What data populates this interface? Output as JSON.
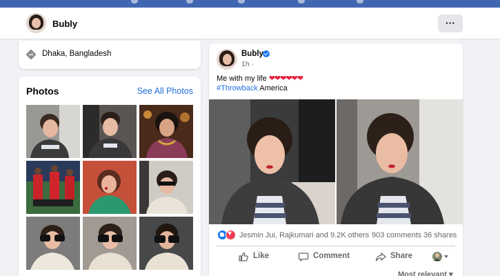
{
  "colors": {
    "brand_bar": "#4267b2",
    "link": "#216fdb",
    "like": "#1877f2",
    "love": "#f33e58",
    "heart": "#e41e3f"
  },
  "profile": {
    "name": "Bubly",
    "more_label": "···"
  },
  "intro": {
    "location": "Dhaka, Bangladesh",
    "icon": "location-icon"
  },
  "photos": {
    "title": "Photos",
    "see_all": "See All Photos",
    "count": 9
  },
  "post": {
    "author": "Bubly",
    "verified": true,
    "time": "1h ·",
    "text": "Me with my life",
    "hearts": "❤❤❤❤❤❤",
    "hashtag": "#Throwback",
    "hashtag_suffix": " America",
    "reactions_text": "Jesmin Jui, Rajkumari and 9.2K others",
    "comments": "903 comments",
    "shares": "36 shares",
    "actions": {
      "like": "Like",
      "comment": "Comment",
      "share": "Share"
    },
    "sort_label": "Most relevant ▾"
  }
}
